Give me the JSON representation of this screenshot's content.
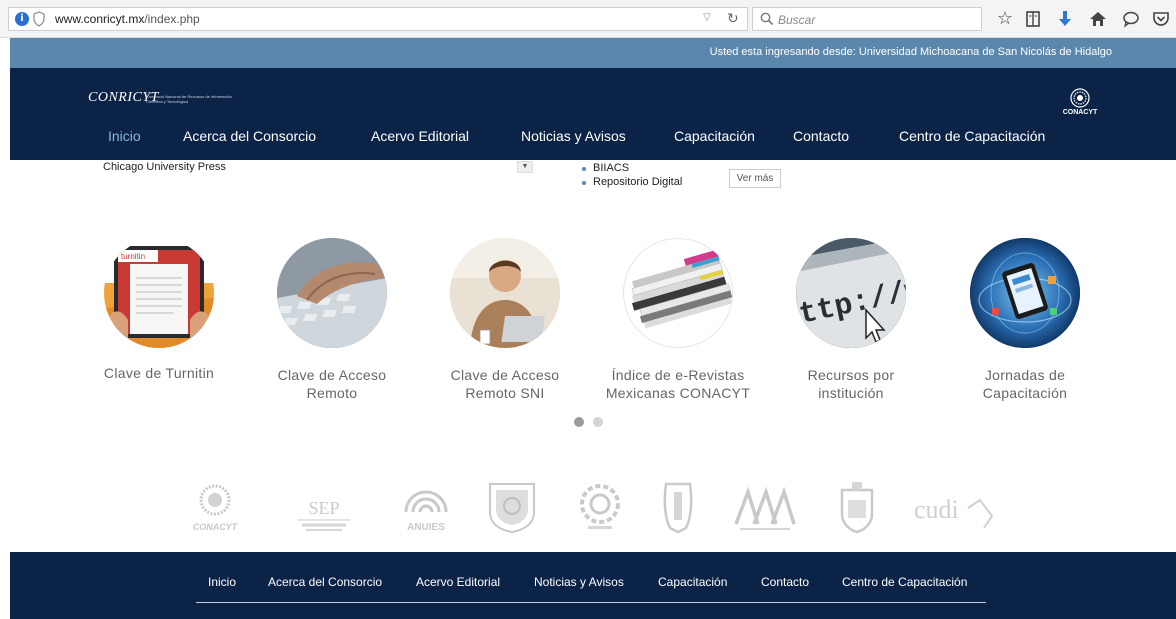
{
  "browser": {
    "url_domain": "www.conricyt.mx",
    "url_path": "/index.php",
    "search_placeholder": "Buscar"
  },
  "login": {
    "text": "Usted esta ingresando desde: Universidad Michoacana de San Nicolás de Hidalgo"
  },
  "header": {
    "logo_text": "CONRICYT",
    "logo_subtitle": "Consorcio Nacional de Recursos de Información Científica y Tecnológica",
    "badge_text": "CONACYT",
    "nav": [
      {
        "label": "Inicio"
      },
      {
        "label": "Acerca del Consorcio"
      },
      {
        "label": "Acervo Editorial"
      },
      {
        "label": "Noticias y Avisos"
      },
      {
        "label": "Capacitación"
      },
      {
        "label": "Contacto"
      },
      {
        "label": "Centro de Capacitación"
      }
    ]
  },
  "partial": {
    "select_value": "Chicago University Press",
    "list": [
      "BIIACS",
      "Repositorio Digital"
    ],
    "ver_mas": "Ver más"
  },
  "carousel": {
    "items": [
      {
        "line1": "Clave de Turnitin",
        "line2": ""
      },
      {
        "line1": "Clave de Acceso",
        "line2": "Remoto"
      },
      {
        "line1": "Clave de Acceso",
        "line2": "Remoto SNI"
      },
      {
        "line1": "Índice de e-Revistas",
        "line2": "Mexicanas CONACYT"
      },
      {
        "line1": "Recursos por",
        "line2": "institución"
      },
      {
        "line1": "Jornadas de",
        "line2": "Capacitación"
      }
    ],
    "turnitin_text": "turnitin",
    "url_text": "ttp://w",
    "active_dot": 1,
    "dot_count": 2
  },
  "partners": {
    "conacyt": "CONACYT",
    "sep": "SEP",
    "anuies": "ANUIES",
    "cudi": "cudi"
  },
  "footer": {
    "nav": [
      {
        "label": "Inicio"
      },
      {
        "label": "Acerca del Consorcio"
      },
      {
        "label": "Acervo Editorial"
      },
      {
        "label": "Noticias y Avisos"
      },
      {
        "label": "Capacitación"
      },
      {
        "label": "Contacto"
      },
      {
        "label": "Centro de Capacitación"
      }
    ]
  },
  "colors": {
    "navy": "#0b2347",
    "strip": "#5c87ad",
    "active_nav": "#8bb6e0",
    "dot_active": "#9a9a9a",
    "dot_inactive": "#d4d4d4"
  }
}
